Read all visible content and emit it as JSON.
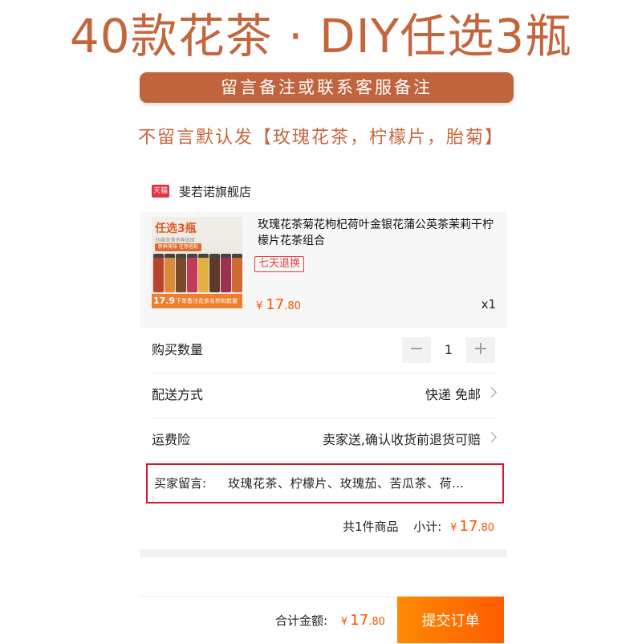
{
  "hero": {
    "title": "40款花茶 · DIY任选3瓶",
    "banner": "留言备注或联系客服备注",
    "default_note": "不留言默认发【玫瑰花茶，柠檬片，胎菊】"
  },
  "store": {
    "badge": "天猫",
    "name": "斐若诺旗舰店"
  },
  "product": {
    "title": "玫瑰花茶菊花枸杞荷叶金银花蒲公英茶茉莉干柠檬片花茶组合",
    "return_badge": "七天退换",
    "currency": "¥",
    "price_int": "17",
    "price_dec": ".80",
    "quantity_text": "x1",
    "thumbnail": {
      "tag": "任选3瓶",
      "sub": "39款花茶多种选择",
      "pill": "新鲜美味 任意搭配",
      "price": "17.9",
      "bar_text": "下单备注花茶名称和数量",
      "jar_colors": [
        "#b8432f",
        "#d98a3a",
        "#7a4a2a",
        "#c23a5a",
        "#e0b040",
        "#5e3a2a",
        "#a03050",
        "#d06a30"
      ]
    }
  },
  "rows": {
    "quantity_label": "购买数量",
    "quantity_value": "1",
    "minus": "−",
    "plus": "+",
    "shipping_label": "配送方式",
    "shipping_value": "快递 免邮",
    "insurance_label": "运费险",
    "insurance_value": "卖家送,确认收货前退货可赔"
  },
  "message": {
    "label": "买家留言:",
    "value": "玫瑰花茶、柠檬片、玫瑰茄、苦瓜茶、荷…"
  },
  "subtotal": {
    "count_text": "共1件商品",
    "label": "小计:",
    "currency": "¥",
    "int": "17",
    "dec": ".80"
  },
  "footer": {
    "total_label": "合计金额:",
    "currency": "¥",
    "int": "17",
    "dec": ".80",
    "submit": "提交订单"
  },
  "colors": {
    "accent": "#c4663d",
    "price": "#ff5000",
    "highlight_border": "#d9142b",
    "submit": "#ff6a00"
  }
}
